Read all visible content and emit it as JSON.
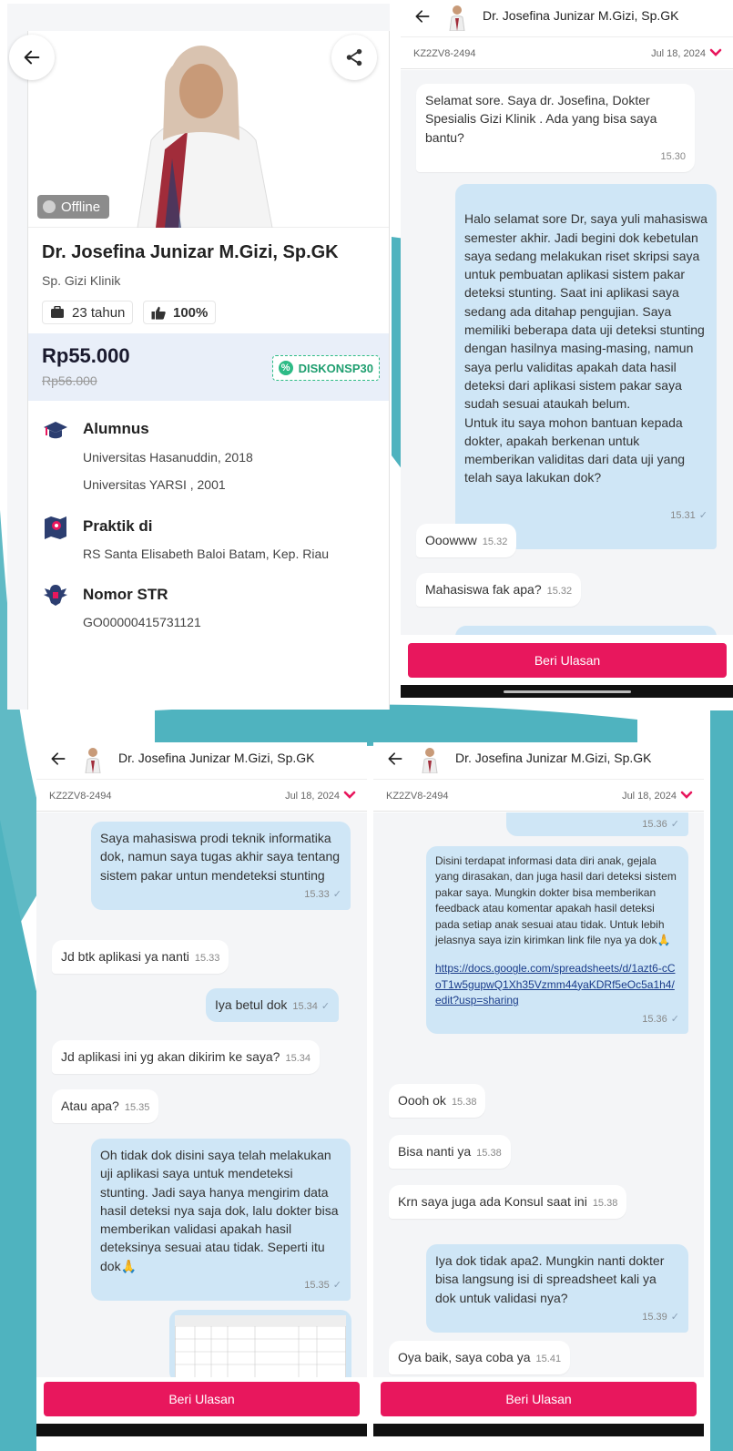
{
  "profile": {
    "status_badge": "Offline",
    "doctor_name": "Dr. Josefina Junizar M.Gizi, Sp.GK",
    "specialty": "Sp. Gizi Klinik",
    "experience": "23 tahun",
    "rating": "100%",
    "price": "Rp55.000",
    "old_price": "Rp56.000",
    "promo_code": "DISKONSP30",
    "alumni_title": "Alumnus",
    "alumni_items": [
      "Universitas Hasanuddin, 2018",
      "Universitas YARSI , 2001"
    ],
    "practice_title": "Praktik di",
    "practice_place": "RS Santa Elisabeth Baloi Batam, Kep. Riau",
    "str_title": "Nomor STR",
    "str_number": "GO00000415731121"
  },
  "chat": {
    "doctor_name": "Dr. Josefina Junizar M.Gizi, Sp.GK",
    "consult_code": "KZ2ZV8-2494",
    "date": "Jul 18, 2024",
    "review_button": "Beri Ulasan",
    "panel2_messages": [
      {
        "dir": "in",
        "text": "Selamat sore.  Saya dr. Josefina, Dokter Spesialis Gizi Klinik . Ada yang bisa saya bantu?",
        "time": "15.30"
      },
      {
        "dir": "out",
        "text": "Halo selamat sore Dr, saya yuli mahasiswa semester akhir.  Jadi begini dok kebetulan saya sedang melakukan riset skripsi saya untuk pembuatan aplikasi sistem pakar deteksi stunting. Saat ini aplikasi saya sedang ada ditahap pengujian. Saya memiliki beberapa data uji deteksi stunting dengan hasilnya masing-masing, namun saya perlu validitas apakah data hasil deteksi dari aplikasi sistem pakar saya sudah sesuai ataukah belum.\nUntuk itu saya mohon bantuan kepada dokter, apakah berkenan untuk memberikan validitas dari data uji yang telah saya lakukan dok?",
        "time": "15.31"
      },
      {
        "dir": "in",
        "text": "Ooowww",
        "time": "15.32"
      },
      {
        "dir": "in",
        "text": "Mahasiswa fak apa?",
        "time": "15.32"
      }
    ],
    "panel3_messages": [
      {
        "dir": "out",
        "text": "Saya mahasiswa prodi teknik informatika dok, namun saya tugas akhir saya tentang sistem pakar untun mendeteksi stunting",
        "time": "15.33"
      },
      {
        "dir": "in",
        "text": "Jd btk aplikasi ya nanti",
        "time": "15.33"
      },
      {
        "dir": "out",
        "text": "Iya betul dok",
        "time": "15.34"
      },
      {
        "dir": "in",
        "text": "Jd aplikasi ini yg akan dikirim ke saya?",
        "time": "15.34"
      },
      {
        "dir": "in",
        "text": "Atau apa?",
        "time": "15.35"
      },
      {
        "dir": "out",
        "text": "Oh tidak dok disini saya telah melakukan uji aplikasi saya untuk mendeteksi stunting. Jadi saya hanya mengirim data hasil deteksi nya saja dok, lalu dokter bisa memberikan validasi apakah hasil deteksinya sesuai atau tidak. Seperti itu dok🙏",
        "time": "15.35"
      }
    ],
    "panel4_messages": [
      {
        "dir": "out",
        "text": "",
        "time": "15.36"
      },
      {
        "dir": "out",
        "text": "Disini terdapat informasi data diri anak, gejala yang dirasakan, dan juga hasil dari deteksi sistem pakar saya. Mungkin dokter bisa memberikan feedback atau komentar apakah hasil deteksi pada setiap anak sesuai atau tidak. Untuk lebih jelasnya saya izin kirimkan link file nya ya dok🙏",
        "link": "https://docs.google.com/spreadsheets/d/1azt6-cCoT1w5gupwQ1Xh35Vzmm44yaKDRf5eOc5a1h4/edit?usp=sharing",
        "time": "15.36"
      },
      {
        "dir": "in",
        "text": "Oooh ok",
        "time": "15.38"
      },
      {
        "dir": "in",
        "text": "Bisa nanti ya",
        "time": "15.38"
      },
      {
        "dir": "in",
        "text": "Krn saya juga ada Konsul saat ini",
        "time": "15.38"
      },
      {
        "dir": "out",
        "text": "Iya dok tidak apa2. Mungkin nanti dokter bisa langsung isi di spreadsheet kali ya dok untuk validasi nya?",
        "time": "15.39"
      },
      {
        "dir": "in",
        "text": "Oya baik, saya coba ya",
        "time": "15.41"
      }
    ]
  },
  "colors": {
    "accent": "#e8175d",
    "out_bubble": "#cfe6f6",
    "teal_decor": "#4fb3bf",
    "promo_green": "#2dbb86"
  }
}
